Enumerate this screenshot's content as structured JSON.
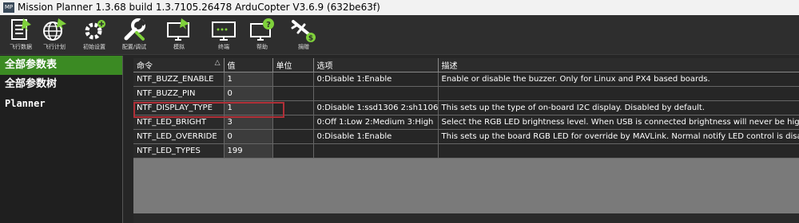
{
  "window": {
    "title": "Mission Planner 1.3.68 build 1.3.7105.26478 ArduCopter V3.6.9 (632be63f)",
    "app_icon": "MP"
  },
  "toolbar": {
    "items": [
      {
        "label": "飞行数据",
        "icon": "flight-data-icon"
      },
      {
        "label": "飞行计划",
        "icon": "flight-plan-icon"
      },
      {
        "label": "初始设置",
        "icon": "initial-setup-icon"
      },
      {
        "label": "配置/调试",
        "icon": "config-tuning-icon"
      },
      {
        "label": "模拟",
        "icon": "simulation-icon"
      },
      {
        "label": "终端",
        "icon": "terminal-icon"
      },
      {
        "label": "帮助",
        "icon": "help-icon"
      },
      {
        "label": "捐赠",
        "icon": "donate-icon"
      }
    ]
  },
  "sidebar": {
    "items": [
      {
        "label": "全部参数表",
        "active": true
      },
      {
        "label": "全部参数树",
        "active": false
      },
      {
        "label": "Planner",
        "active": false
      }
    ]
  },
  "table": {
    "columns": [
      "命令",
      "值",
      "单位",
      "选项",
      "描述"
    ],
    "sort_glyph": "△",
    "rows": [
      {
        "name": "NTF_BUZZ_ENABLE",
        "value": "1",
        "units": "",
        "options": "0:Disable 1:Enable",
        "desc": "Enable or disable the buzzer. Only for Linux and PX4 based boards."
      },
      {
        "name": "NTF_BUZZ_PIN",
        "value": "0",
        "units": "",
        "options": "",
        "desc": ""
      },
      {
        "name": "NTF_DISPLAY_TYPE",
        "value": "1",
        "units": "",
        "options": "0:Disable 1:ssd1306 2:sh1106",
        "desc": "This sets up the type of on-board I2C display. Disabled by default."
      },
      {
        "name": "NTF_LED_BRIGHT",
        "value": "3",
        "units": "",
        "options": "0:Off 1:Low 2:Medium 3:High",
        "desc": "Select the RGB LED brightness level. When USB is connected brightness will never be higher than low reg"
      },
      {
        "name": "NTF_LED_OVERRIDE",
        "value": "0",
        "units": "",
        "options": "0:Disable 1:Enable",
        "desc": "This sets up the board RGB LED for override by MAVLink. Normal notify LED control is disabled"
      },
      {
        "name": "NTF_LED_TYPES",
        "value": "199",
        "units": "",
        "options": "",
        "desc": ""
      }
    ],
    "highlighted_row": "NTF_DISPLAY_TYPE",
    "highlight_color": "#b03038"
  },
  "colors": {
    "accent": "#3b8a23",
    "background": "#262626",
    "icon_green": "#7fd13b"
  }
}
